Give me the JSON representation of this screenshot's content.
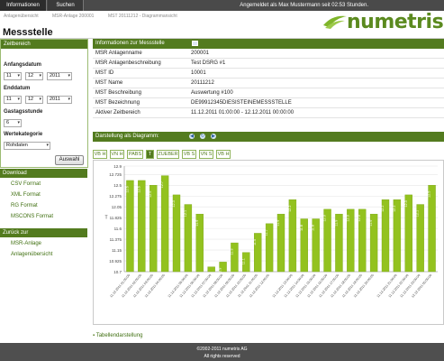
{
  "topbar": {
    "tabs": [
      "Informationen",
      "Suchen"
    ],
    "user_status": "Angemeldet als Max Mustermann seit 02:53 Stunden."
  },
  "breadcrumb": [
    "Anlagenübersicht",
    "MSR-Anlage 200001",
    "MST 20111212 - Diagrammansicht"
  ],
  "logo": {
    "text": "numetris"
  },
  "page": {
    "title": "Messstelle"
  },
  "sidebar": {
    "zeitbereich": {
      "header": "Zeitbereich",
      "start_label": "Anfangsdatum",
      "start": {
        "day": "11",
        "month": "12",
        "year": "2011"
      },
      "end_label": "Enddatum",
      "end": {
        "day": "11",
        "month": "12",
        "year": "2011"
      },
      "gasstunde_label": "Gastagsstunde",
      "gasstunde": "6",
      "werte_label": "Wertekategorie",
      "werte": "Rohdaten",
      "apply_label": "Auswahl"
    },
    "download": {
      "header": "Download",
      "items": [
        "CSV Format",
        "XML Format",
        "RG Format",
        "MSCONS Format"
      ]
    },
    "zurueck": {
      "header": "Zurück zur",
      "items": [
        "MSR-Anlage",
        "Anlagenübersicht"
      ]
    }
  },
  "info": {
    "header": "Informationen zur Messstelle",
    "rows": [
      {
        "key": "MSR Anlagenname",
        "value": "200001"
      },
      {
        "key": "MSR Anlagenbeschreibung",
        "value": "Test DSRG #1"
      },
      {
        "key": "MST ID",
        "value": "10001"
      },
      {
        "key": "MST Name",
        "value": "20111212"
      },
      {
        "key": "MST Beschreibung",
        "value": "Auswertung #100"
      },
      {
        "key": "MST Bezeichnung",
        "value": "DE99912345DIESISTEINEMESSSTELLE"
      },
      {
        "key": "Aktiver Zeitbereich",
        "value": "11.12.2011 01:00:00 - 12.12.2011 00:00:00"
      }
    ]
  },
  "diagram": {
    "header": "Darstellung als Diagramm:",
    "tabs": [
      {
        "label": "VB H",
        "active": false
      },
      {
        "label": "VN H",
        "active": false
      },
      {
        "label": "PABS",
        "active": false
      },
      {
        "label": "T",
        "active": true
      },
      {
        "label": "ZUEBER",
        "active": false
      },
      {
        "label": "VB S",
        "active": false
      },
      {
        "label": "VN S",
        "active": false
      },
      {
        "label": "VB H",
        "active": false
      }
    ],
    "table_link": "Tabellendarstellung"
  },
  "chart_data": {
    "type": "bar",
    "ylabel": "T",
    "ylim": [
      10.7,
      12.9
    ],
    "yticks": [
      10.7,
      10.925,
      11.15,
      11.375,
      11.6,
      11.825,
      12.05,
      12.275,
      12.5,
      12.725,
      12.9
    ],
    "ytick_labels": [
      "10.7",
      "10.925",
      "11.15",
      "11.375",
      "11.6",
      "11.825",
      "12.05",
      "12.275",
      "12.5",
      "12.725",
      "12.9"
    ],
    "grid": true,
    "bar_color": "#93c21f",
    "categories": [
      "11.12.2011 01:00:00",
      "11.12.2011 02:00:00",
      "11.12.2011 03:00:00",
      "11.12.2011 04:00:00",
      "11.12.2011 05:00:00",
      "11.12.2011 06:00:00",
      "11.12.2011 07:00:00",
      "11.12.2011 08:00:00",
      "11.12.2011 09:00:00",
      "11.12.2011 10:00:00",
      "11.12.2011 11:00:00",
      "11.12.2011 12:00:00",
      "11.12.2011 13:00:00",
      "11.12.2011 14:00:00",
      "11.12.2011 15:00:00",
      "11.12.2011 16:00:00",
      "11.12.2011 17:00:00",
      "11.12.2011 18:00:00",
      "11.12.2011 19:00:00",
      "11.12.2011 20:00:00",
      "11.12.2011 21:00:00",
      "11.12.2011 22:00:00",
      "11.12.2011 23:00:00",
      "12.12.2011 00:00:00"
    ],
    "values": [
      12.6,
      12.6,
      12.5,
      12.7,
      12.3,
      12.1,
      11.9,
      10.8,
      10.9,
      11.3,
      11.1,
      11.5,
      11.7,
      11.9,
      12.2,
      11.8,
      11.8,
      12.0,
      11.9,
      12.0,
      12.0,
      11.9,
      12.2,
      12.2,
      12.3,
      12.1,
      12.5
    ]
  }
}
